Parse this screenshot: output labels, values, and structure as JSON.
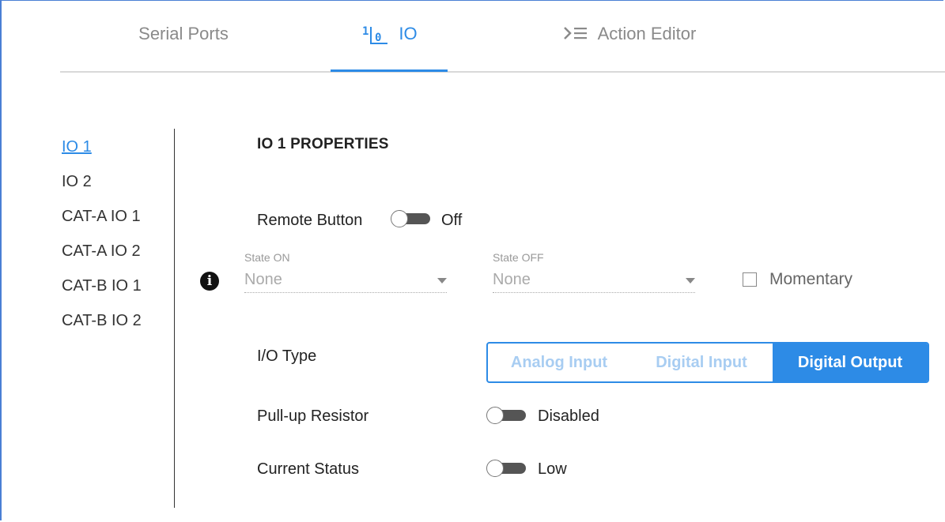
{
  "tabs": [
    {
      "label": "Serial Ports",
      "icon": "serial-ports-icon"
    },
    {
      "label": "IO",
      "icon": "io-binary-icon",
      "active": true
    },
    {
      "label": "Action Editor",
      "icon": "action-editor-icon"
    }
  ],
  "sidebar": {
    "items": [
      {
        "label": "IO 1",
        "active": true
      },
      {
        "label": "IO 2"
      },
      {
        "label": "CAT-A IO 1"
      },
      {
        "label": "CAT-A IO 2"
      },
      {
        "label": "CAT-B IO 1"
      },
      {
        "label": "CAT-B IO 2"
      }
    ]
  },
  "properties": {
    "heading": "IO 1 PROPERTIES",
    "remote_button": {
      "label": "Remote Button",
      "state": "Off"
    },
    "state_on": {
      "caption": "State ON",
      "value": "None"
    },
    "state_off": {
      "caption": "State OFF",
      "value": "None"
    },
    "momentary": {
      "label": "Momentary",
      "checked": false
    },
    "io_type": {
      "label": "I/O Type",
      "options": [
        "Analog Input",
        "Digital Input",
        "Digital Output"
      ],
      "selected": "Digital Output"
    },
    "pullup": {
      "label": "Pull-up Resistor",
      "state": "Disabled"
    },
    "current_status": {
      "label": "Current Status",
      "state": "Low"
    }
  },
  "colors": {
    "accent": "#2d8be6",
    "frame": "#4a7fd4"
  }
}
